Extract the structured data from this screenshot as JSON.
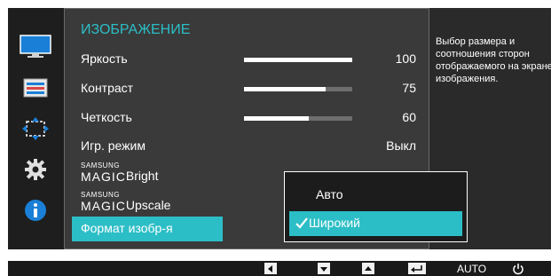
{
  "menu": {
    "title": "ИЗОБРАЖЕНИЕ",
    "items": [
      {
        "label": "Яркость",
        "value": "100",
        "level": 1.0
      },
      {
        "label": "Контраст",
        "value": "75",
        "level": 0.75
      },
      {
        "label": "Четкость",
        "value": "60",
        "level": 0.6
      },
      {
        "label": "Игр. режим",
        "value": "Выкл"
      },
      {
        "brand_top": "SAMSUNG",
        "brand_bottom": "MAGIC",
        "label": "Bright"
      },
      {
        "brand_top": "SAMSUNG",
        "brand_bottom": "MAGIC",
        "label": "Upscale"
      },
      {
        "label": "Формат изобр-я"
      }
    ]
  },
  "dropdown": {
    "options": [
      "Авто",
      "Широкий"
    ],
    "selected": "Широкий"
  },
  "description": "Выбор размера и соотношения сторон отображаемого на экране изображения.",
  "sidebar": {
    "icons": [
      "monitor-icon",
      "settings-list-icon",
      "size-position-icon",
      "gear-icon",
      "info-icon"
    ]
  },
  "bottom_bar": {
    "auto_label": "AUTO",
    "buttons": [
      "left-arrow-icon",
      "down-arrow-icon",
      "up-arrow-icon",
      "enter-icon",
      "auto-label",
      "power-icon"
    ]
  },
  "colors": {
    "accent": "#2cbec6",
    "panel": "#3a3a3a",
    "sidebar": "#1e1e1e"
  }
}
